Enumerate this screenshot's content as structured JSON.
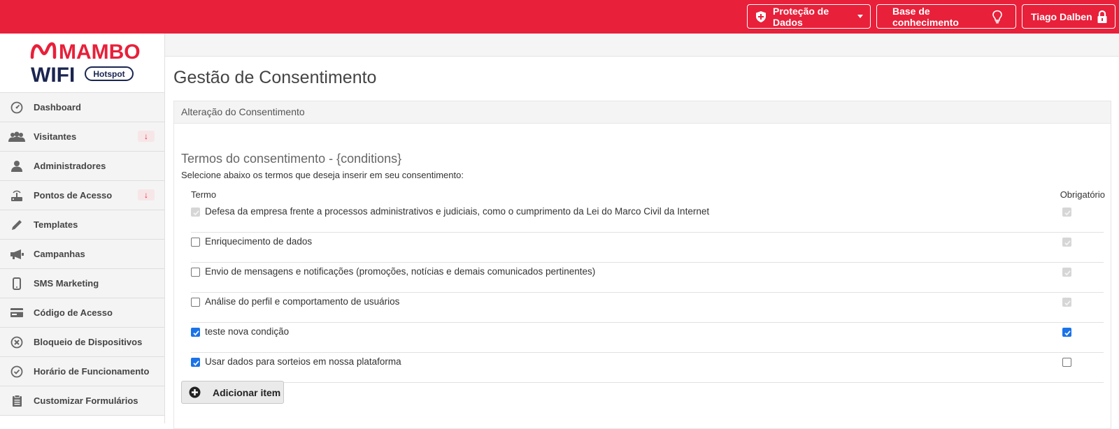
{
  "topbar": {
    "protecao_label": "Proteção de Dados",
    "base_label": "Base de conhecimento",
    "user_label": "Tiago Dalben"
  },
  "logo": {
    "line1": "MAMBO",
    "line2": "WIFI",
    "badge": "Hotspot"
  },
  "sidebar": {
    "items": [
      {
        "label": "Dashboard",
        "icon": "dashboard-icon",
        "badge": ""
      },
      {
        "label": "Visitantes",
        "icon": "users-icon",
        "badge": "↓"
      },
      {
        "label": "Administradores",
        "icon": "user-icon",
        "badge": ""
      },
      {
        "label": "Pontos de Acesso",
        "icon": "router-icon",
        "badge": "↓"
      },
      {
        "label": "Templates",
        "icon": "pencil-icon",
        "badge": ""
      },
      {
        "label": "Campanhas",
        "icon": "megaphone-icon",
        "badge": ""
      },
      {
        "label": "SMS Marketing",
        "icon": "phone-icon",
        "badge": ""
      },
      {
        "label": "Código de Acesso",
        "icon": "card-icon",
        "badge": ""
      },
      {
        "label": "Bloqueio de Dispositivos",
        "icon": "block-icon",
        "badge": ""
      },
      {
        "label": "Horário de Funcionamento",
        "icon": "clock-icon",
        "badge": ""
      },
      {
        "label": "Customizar Formulários",
        "icon": "clipboard-icon",
        "badge": ""
      }
    ]
  },
  "main": {
    "title": "Gestão de Consentimento",
    "panel_title": "Alteração do Consentimento",
    "section_title": "Termos do consentimento - {conditions}",
    "section_desc": "Selecione abaixo os termos que deseja inserir em seu consentimento:",
    "col_termo": "Termo",
    "col_obrigatorio": "Obrigatório",
    "terms": [
      {
        "label": "Defesa da empresa frente a processos administrativos e judiciais, como o cumprimento da Lei do Marco Civil da Internet",
        "checked": "disabled",
        "required": "disabled"
      },
      {
        "label": "Enriquecimento de dados",
        "checked": "off",
        "required": "disabled"
      },
      {
        "label": "Envio de mensagens e notificações (promoções, notícias e demais comunicados pertinentes)",
        "checked": "off",
        "required": "disabled"
      },
      {
        "label": "Análise do perfil e comportamento de usuários",
        "checked": "off",
        "required": "disabled"
      },
      {
        "label": "teste nova condição",
        "checked": "on",
        "required": "on"
      },
      {
        "label": "Usar dados para sorteios em nossa plataforma",
        "checked": "on",
        "required": "off"
      }
    ],
    "add_button": "Adicionar item"
  },
  "colors": {
    "brand_red": "#e8203a",
    "logo_navy": "#1b2550",
    "checkbox_blue": "#1a73e8"
  }
}
